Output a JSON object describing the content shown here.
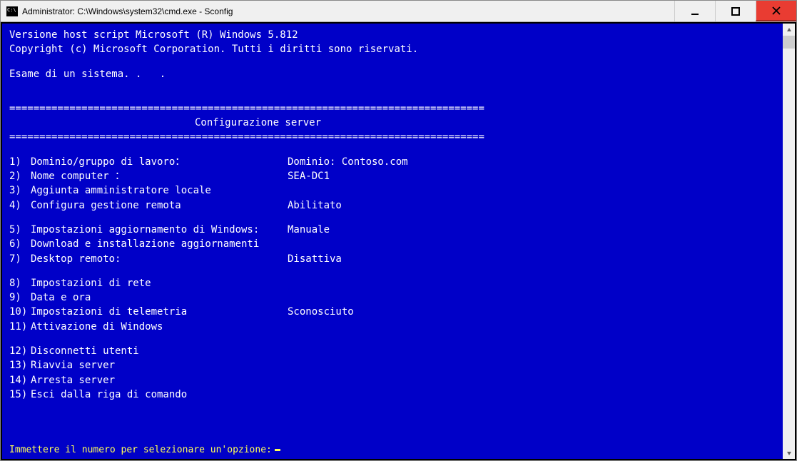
{
  "titlebar": {
    "title": "Administrator: C:\\Windows\\system32\\cmd.exe - Sconfig"
  },
  "header": {
    "line1": "Versione host script Microsoft (R) Windows 5.812",
    "line2": "Copyright (c) Microsoft Corporation. Tutti i diritti sono riservati.",
    "line3": "Esame di un sistema. .   ."
  },
  "divider": "===============================================================================",
  "section_title": "Configurazione server",
  "menu": {
    "item1": {
      "num": "1)",
      "label": "Dominio/gruppo di lavoro：",
      "value": "Dominio: Contoso.com"
    },
    "item2": {
      "num": "2)",
      "label": "Nome computer ：",
      "value": "SEA-DC1"
    },
    "item3": {
      "num": "3)",
      "label": "Aggiunta amministratore locale",
      "value": ""
    },
    "item4": {
      "num": "4)",
      "label": "Configura gestione remota",
      "value": "Abilitato"
    },
    "item5": {
      "num": "5)",
      "label": "Impostazioni aggiornamento di Windows:",
      "value": "Manuale"
    },
    "item6": {
      "num": "6)",
      "label": "Download e installazione aggiornamenti",
      "value": ""
    },
    "item7": {
      "num": "7)",
      "label": "Desktop remoto:",
      "value": "Disattiva"
    },
    "item8": {
      "num": "8)",
      "label": "Impostazioni di rete",
      "value": ""
    },
    "item9": {
      "num": "9)",
      "label": "Data e ora",
      "value": ""
    },
    "item10": {
      "num": "10)",
      "label": "Impostazioni di telemetria",
      "value": "Sconosciuto"
    },
    "item11": {
      "num": "11)",
      "label": "Attivazione di Windows",
      "value": ""
    },
    "item12": {
      "num": "12)",
      "label": "Disconnetti utenti",
      "value": ""
    },
    "item13": {
      "num": "13)",
      "label": "Riavvia server",
      "value": ""
    },
    "item14": {
      "num": "14)",
      "label": "Arresta server",
      "value": ""
    },
    "item15": {
      "num": "15)",
      "label": "Esci dalla riga di comando",
      "value": ""
    }
  },
  "prompt": "Immettere il numero per selezionare un'opzione:"
}
